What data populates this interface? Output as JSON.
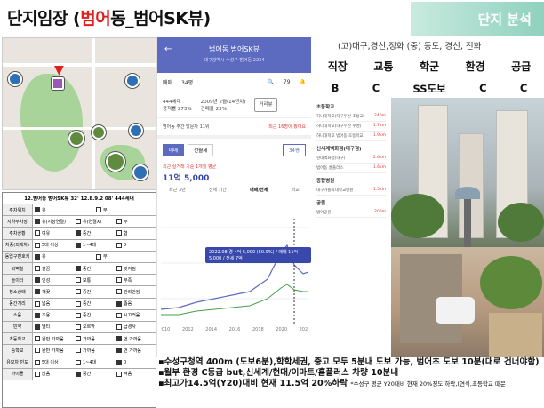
{
  "title": {
    "prefix": "단지임장 (",
    "highlight": "범어",
    "suffix": "동_범어SK뷰)"
  },
  "badge": "단지 분석",
  "scores": {
    "note": "(고)대구,경신,정화 (중) 동도, 경신, 전화",
    "headers": [
      "직장",
      "교통",
      "학군",
      "환경",
      "공급"
    ],
    "values": [
      "B",
      "C",
      "SS도보",
      "C",
      "C"
    ]
  },
  "checklist": {
    "header": "12.범어동 범어SK뷰 32' 12.8.9.2 08' 444세대",
    "rows": [
      {
        "label": "주차위치",
        "opts": [
          "유",
          "무"
        ],
        "checked": [
          0
        ]
      },
      {
        "label": "지하주차장",
        "opts": [
          "유(지상연결)",
          "유(연결X)",
          "무"
        ],
        "checked": [
          0
        ]
      },
      {
        "label": "주차상황",
        "opts": [
          "여유",
          "중간",
          "협"
        ],
        "checked": [
          1
        ]
      },
      {
        "label": "차종(외제차)",
        "opts": [
          "5대 이상",
          "1~4대",
          "0"
        ],
        "checked": [
          1
        ]
      },
      {
        "label": "동입구번호키",
        "opts": [
          "유",
          "무"
        ],
        "checked": [
          0
        ]
      },
      {
        "label": "외벽칠",
        "opts": [
          "깔끔",
          "중간",
          "벗겨짐"
        ],
        "checked": [
          1
        ]
      },
      {
        "label": "놀이터",
        "opts": [
          "인성",
          "보통",
          "부족"
        ],
        "checked": [
          0
        ]
      },
      {
        "label": "청소상태",
        "opts": [
          "깨끗",
          "중간",
          "관리안됨"
        ],
        "checked": [
          0
        ]
      },
      {
        "label": "동간거리",
        "opts": [
          "넓음",
          "중간",
          "좁음"
        ],
        "checked": [
          2
        ]
      },
      {
        "label": "소음",
        "opts": [
          "조용",
          "중간",
          "시끄러움"
        ],
        "checked": [
          0
        ]
      },
      {
        "label": "빈약",
        "opts": [
          "엘티",
          "오르막",
          "급경사"
        ],
        "checked": [
          0
        ]
      },
      {
        "label": "초등학교",
        "opts": [
          "완만 가까움",
          "가까움",
          "먼 가까움"
        ],
        "checked": [
          2
        ]
      },
      {
        "label": "중학교",
        "opts": [
          "완만 가까움",
          "가까움",
          "먼 가까움"
        ],
        "checked": [
          2
        ]
      },
      {
        "label": "유모차 빈도",
        "opts": [
          "5대 이상",
          "1~4대",
          "0"
        ],
        "checked": [
          2
        ]
      },
      {
        "label": "아이들",
        "opts": [
          "많음",
          "중간",
          "적음"
        ],
        "checked": [
          1
        ]
      }
    ]
  },
  "phone": {
    "title": "범어동 범어SK뷰",
    "address": "대구광역시 수성구 범어동 2234",
    "tabs": [
      "매매",
      "34평",
      "79"
    ],
    "info": [
      "444세대",
      "2009년 2월(14년차)",
      "용적률 273%",
      "건폐율 23%"
    ],
    "nearby_btn": "거리뷰",
    "visit_label": "범어동 주간 방문자 11위",
    "visit_link": "최근 16명이 봤어요",
    "seg": [
      "매매",
      "전월세"
    ],
    "pyeong": "34평",
    "price_label": "최근 실거래 기준 1개월 평균",
    "price": "11억 5,000",
    "range": [
      "최근 3년",
      "전체 기간",
      "매매/전세",
      "비교"
    ],
    "tooltip": "2022.08 경 4억 5,000 (60.9%) / 매매 11억 5,000 / 전세 7억",
    "chart_years": [
      "2010",
      "2012",
      "2014",
      "2016",
      "2018",
      "2020",
      "2022"
    ]
  },
  "school": {
    "head1": "초등학교",
    "items1": [
      {
        "name": "하나대학교(대구두산 초등교)",
        "dist": "240m"
      },
      {
        "name": "하나대학교(대구두산 수성)",
        "dist": "1.7km"
      },
      {
        "name": "하나대학교 범어동 초등학교",
        "dist": "1.9km"
      }
    ],
    "head2": "신세계백화점(대구점)",
    "items2": [
      {
        "name": "현대백화점(대구)",
        "dist": "2.6km"
      },
      {
        "name": "범어동 홈플러스",
        "dist": "1.6km"
      }
    ],
    "head3": "종합병원",
    "items3": [
      {
        "name": "대구가톨릭대학교병원",
        "dist": "1.5km"
      }
    ],
    "head4": "공원",
    "items4": [
      {
        "name": "범어공원",
        "dist": "200m"
      }
    ]
  },
  "bullets": [
    "▪수성구청역 400m (도보6분),학학세권, 중고 모두 5분내 도보 가능, 범어초 도보 10분(대로 건너야함)",
    "▪월부 환경 C등급 but,신세계/현대/이마트/홈플러스 차량 10분내",
    "▪최고가14.5억(Y20)대비 현재 11.5억 20%하락"
  ],
  "bullet_note": "*수성구 평균 Y20대비 현재 20%정도 하락,(연식,초등학교 때문"
}
